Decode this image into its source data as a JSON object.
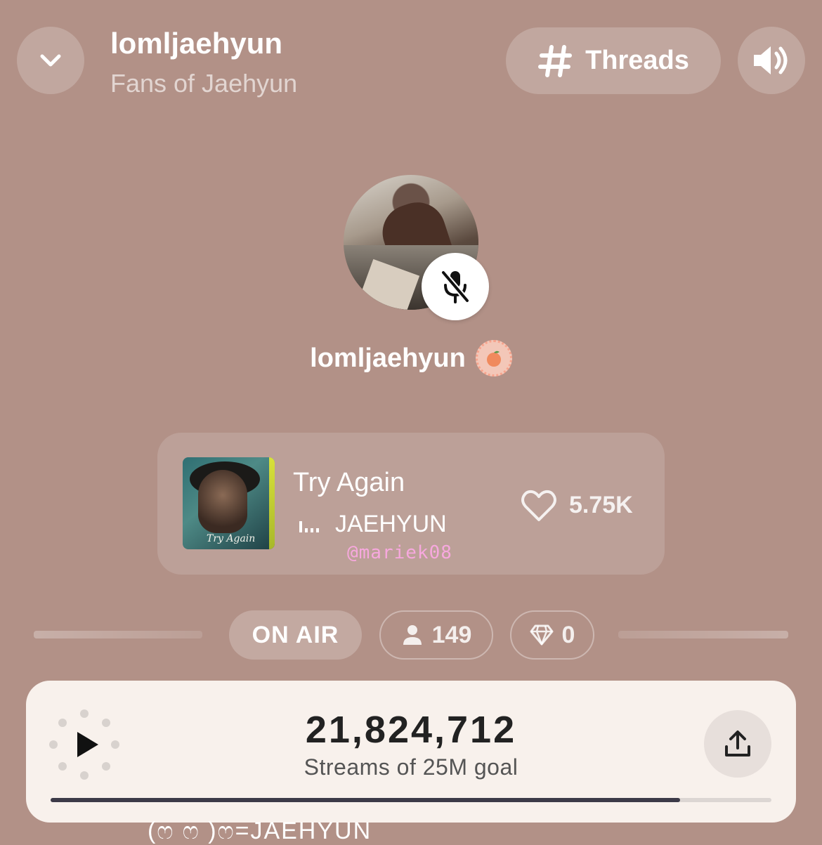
{
  "header": {
    "room_name": "lomljaehyun",
    "subtitle": "Fans of Jaehyun",
    "threads_label": "Threads"
  },
  "host": {
    "name": "lomljaehyun",
    "badge_icon": "peach-emoji-icon",
    "mic_state": "muted"
  },
  "now_playing": {
    "title": "Try Again",
    "artist": "JAEHYUN",
    "likes": "5.75K",
    "album_art_text": "Try Again",
    "watermark": "@mariek08"
  },
  "status": {
    "on_air_label": "ON AIR",
    "listeners": "149",
    "gems": "0"
  },
  "streams": {
    "count": "21,824,712",
    "goal_label": "Streams of 25M goal",
    "progress_fraction": 0.873
  },
  "next_preview": "(ෆ ෆ )ෆ=JAEHYUN",
  "colors": {
    "background": "#b29187",
    "card": "#f8f1ec",
    "progress": "#3c3a48",
    "watermark": "#f7a8de"
  }
}
